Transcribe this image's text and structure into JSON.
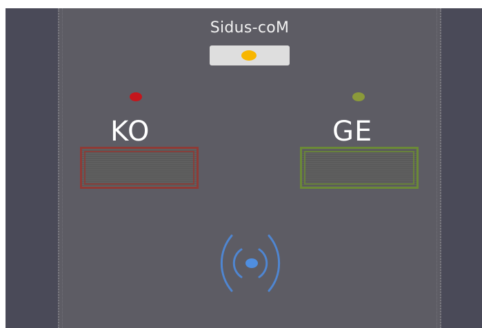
{
  "header": {
    "title": "Sidus-coM"
  },
  "status": {
    "indicator_color": "#f8b600"
  },
  "channels": [
    {
      "label": "KO",
      "led_color": "#c4161c",
      "border_color": "#8f3a35",
      "value": ""
    },
    {
      "label": "GE",
      "led_color": "#8b9a3a",
      "border_color": "#6b8a36",
      "value": ""
    }
  ],
  "signal": {
    "icon": "wireless-signal-icon",
    "color": "#4f86d2",
    "center_color": "#4f8ee0"
  }
}
